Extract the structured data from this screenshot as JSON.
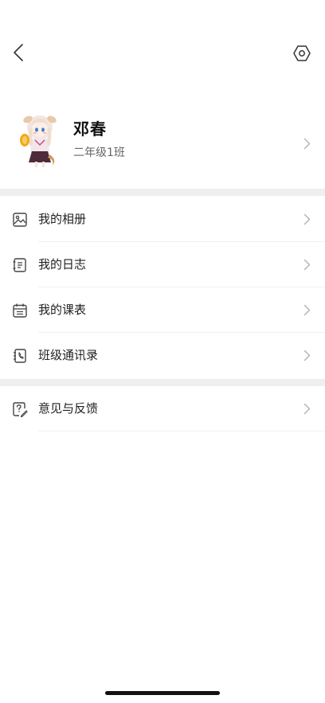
{
  "header": {
    "back_icon": "chevron-left-icon",
    "settings_icon": "hexagon-settings-icon"
  },
  "profile": {
    "name": "邓春",
    "class_name": "二年级1班",
    "avatar_icon": "anime-girl-avatar"
  },
  "menu_groups": [
    {
      "items": [
        {
          "label": "我的相册",
          "icon": "photo-album-icon"
        },
        {
          "label": "我的日志",
          "icon": "journal-icon"
        },
        {
          "label": "我的课表",
          "icon": "calendar-icon"
        },
        {
          "label": "班级通讯录",
          "icon": "address-book-icon"
        }
      ]
    },
    {
      "items": [
        {
          "label": "意见与反馈",
          "icon": "feedback-icon"
        }
      ]
    }
  ],
  "colors": {
    "background": "#ffffff",
    "separator": "#efefef",
    "text_primary": "#1f1f1f",
    "text_secondary": "#666666",
    "chevron": "#b5b5b5"
  }
}
